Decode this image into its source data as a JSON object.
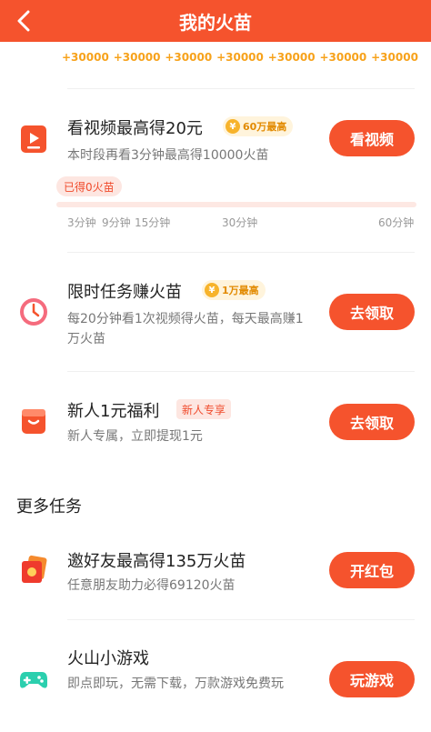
{
  "header": {
    "title": "我的火苗"
  },
  "points_row": [
    "+30000",
    "+30000",
    "+30000",
    "+30000",
    "+30000",
    "+30000",
    "+30000"
  ],
  "tasks": {
    "video": {
      "title": "看视频最高得20元",
      "badge": "60万最高",
      "desc": "本时段再看3分钟最高得10000火苗",
      "button": "看视频",
      "earned": "已得0火苗",
      "progress_value": 0,
      "ticks": [
        "3分钟",
        "9分钟",
        "15分钟",
        "30分钟",
        "60分钟"
      ]
    },
    "limited": {
      "title": "限时任务赚火苗",
      "badge": "1万最高",
      "desc": "每20分钟看1次视频得火苗，每天最高赚1万火苗",
      "button": "去领取"
    },
    "newbie": {
      "title": "新人1元福利",
      "tag": "新人专享",
      "desc": "新人专属，立即提现1元",
      "button": "去领取"
    }
  },
  "more": {
    "title": "更多任务",
    "invite": {
      "title": "邀好友最高得135万火苗",
      "desc": "任意朋友助力必得69120火苗",
      "button": "开红包"
    },
    "game": {
      "title": "火山小游戏",
      "desc": "即点即玩，无需下载，万款游戏免费玩",
      "button": "玩游戏"
    }
  },
  "colors": {
    "brand": "#f5532d",
    "coin": "#f7a21b"
  },
  "icons": [
    "back-arrow-icon",
    "video-play-icon",
    "clock-icon",
    "wallet-icon",
    "red-envelope-icon",
    "gamepad-icon",
    "coin-icon"
  ]
}
